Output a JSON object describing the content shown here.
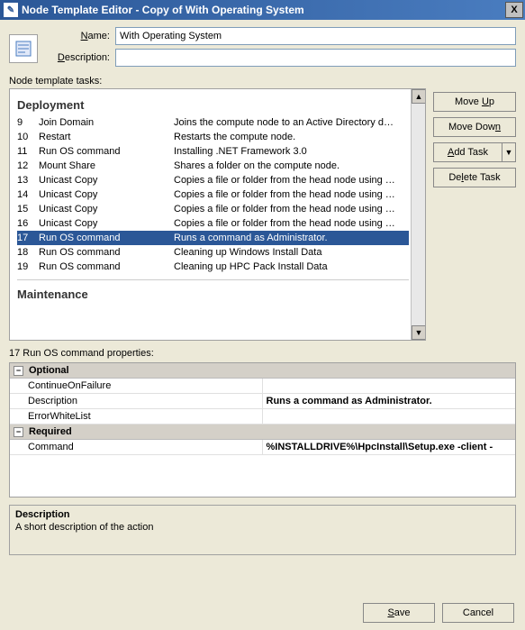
{
  "window": {
    "title": "Node Template Editor - Copy of With Operating System",
    "close_icon": "X"
  },
  "form": {
    "name_label": "Name:",
    "name_value": "With Operating System",
    "description_label": "Description:",
    "description_value": ""
  },
  "tasks": {
    "section_label": "Node template tasks:",
    "groups": {
      "deployment": "Deployment",
      "maintenance": "Maintenance"
    },
    "rows": [
      {
        "num": 9,
        "name": "Join Domain",
        "desc": "Joins the compute node to an Active Directory d…",
        "selected": false
      },
      {
        "num": 10,
        "name": "Restart",
        "desc": "Restarts the compute node.",
        "selected": false
      },
      {
        "num": 11,
        "name": "Run OS command",
        "desc": "Installing .NET Framework 3.0",
        "selected": false
      },
      {
        "num": 12,
        "name": "Mount Share",
        "desc": "Shares a folder on the compute node.",
        "selected": false
      },
      {
        "num": 13,
        "name": "Unicast Copy",
        "desc": "Copies a file or folder from the head node using …",
        "selected": false
      },
      {
        "num": 14,
        "name": "Unicast Copy",
        "desc": "Copies a file or folder from the head node using …",
        "selected": false
      },
      {
        "num": 15,
        "name": "Unicast Copy",
        "desc": "Copies a file or folder from the head node using …",
        "selected": false
      },
      {
        "num": 16,
        "name": "Unicast Copy",
        "desc": "Copies a file or folder from the head node using …",
        "selected": false
      },
      {
        "num": 17,
        "name": "Run OS command",
        "desc": "Runs a command as Administrator.",
        "selected": true
      },
      {
        "num": 18,
        "name": "Run OS command",
        "desc": "Cleaning up Windows Install Data",
        "selected": false
      },
      {
        "num": 19,
        "name": "Run OS command",
        "desc": "Cleaning up HPC Pack Install Data",
        "selected": false
      }
    ]
  },
  "side_buttons": {
    "move_up": "Move Up",
    "move_down": "Move Down",
    "add_task": "Add Task",
    "delete_task": "Delete Task"
  },
  "properties": {
    "label": "17 Run OS command properties:",
    "groups": [
      {
        "name": "Optional",
        "rows": [
          {
            "name": "ContinueOnFailure",
            "value": ""
          },
          {
            "name": "Description",
            "value": "Runs a command as Administrator."
          },
          {
            "name": "ErrorWhiteList",
            "value": ""
          }
        ]
      },
      {
        "name": "Required",
        "rows": [
          {
            "name": "Command",
            "value": "%INSTALLDRIVE%\\HpcInstall\\Setup.exe -client -"
          }
        ]
      }
    ],
    "desc_box": {
      "title": "Description",
      "text": "A short description of the action"
    }
  },
  "bottom": {
    "save": "Save",
    "cancel": "Cancel"
  }
}
